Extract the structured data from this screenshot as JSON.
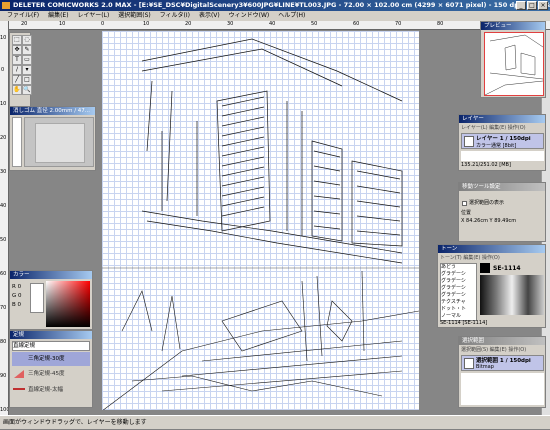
{
  "window": {
    "title": "DELETER COMICWORKS 2.0 MAX - [E:¥SE_DSC¥DigitalScenery3¥600JPG¥LINE¥TL003.JPG - 72.00 × 102.00 cm (4299 × 6071 pixel) - 150 dpi - 16.6%表示]",
    "min_label": "_",
    "max_label": "□",
    "close_label": "×"
  },
  "menu": [
    "ファイル(F)",
    "編集(E)",
    "レイヤー(L)",
    "選択範囲(S)",
    "フィルタ(I)",
    "表示(V)",
    "ウィンドウ(W)",
    "ヘルプ(H)"
  ],
  "ruler": {
    "top": [
      "20",
      "10",
      "0",
      "10",
      "20",
      "30",
      "40",
      "50",
      "60",
      "70",
      "80"
    ],
    "left": [
      "10",
      "0",
      "10",
      "20",
      "30",
      "40",
      "50",
      "60",
      "70",
      "80",
      "90",
      "100"
    ]
  },
  "toolbox": {
    "icons": [
      "select-tool-icon",
      "lasso-tool-icon",
      "move-tool-icon",
      "pen-tool-icon",
      "text-tool-icon",
      "eraser-tool-icon",
      "brush-tool-icon",
      "fill-tool-icon",
      "line-tool-icon",
      "shape-tool-icon",
      "hand-tool-icon",
      "zoom-tool-icon"
    ]
  },
  "preview": {
    "title": "プレビュー"
  },
  "pen_panel": {
    "title": "消しゴム 直径 2.00mm / 47..."
  },
  "layer_panel": {
    "title": "レイヤー",
    "menu": [
      "レイヤー(L)",
      "編集(E)",
      "操作(O)"
    ],
    "item_name": "レイヤー 1 / 150dpi",
    "item_mode": "カラー通常 [8bit]",
    "size_text": "135.21/251.02 [MB]"
  },
  "move_tool_panel": {
    "title": "移動ツール設定",
    "checkbox_label": "選択範囲の表示",
    "position_label": "位置",
    "x_value": "X 84.26cm",
    "y_value": "Y 89.49cm"
  },
  "tone_panel": {
    "title": "トーン",
    "menu": [
      "トーン(T)",
      "編集(E)",
      "操作(O)"
    ],
    "categories": [
      "あどう",
      "グラデーシ",
      "グラデーシ",
      "グラデーシ",
      "グラデーシ",
      "テクスチャ",
      "ドット・ト",
      "ノーマル"
    ],
    "selected": "SE-1114",
    "status": "SE-1114 [SE-1114]"
  },
  "color_panel": {
    "title": "カラー",
    "r": "R 0",
    "g": "G 0",
    "b": "B 0"
  },
  "ruler_panel": {
    "title": "定規",
    "header": "直線定規",
    "items": [
      "三角定規-30度",
      "三角定規-45度",
      "直線定規-太幅"
    ],
    "selected": "三角定規-30度"
  },
  "selection_panel": {
    "title": "選択範囲",
    "menu": [
      "選択範囲(S)",
      "編集(E)",
      "操作(O)"
    ],
    "item_name": "選択範囲 1 / 150dpi",
    "item_sub": "Bitmap"
  },
  "status_bar": {
    "text": "画面がウィンドウドラッグで、レイヤーを移動します"
  },
  "colors": {
    "title_active": "#0a246a",
    "panel_bg": "#d4d0c8",
    "workspace": "#868686",
    "grid": "#c8d4f0"
  }
}
